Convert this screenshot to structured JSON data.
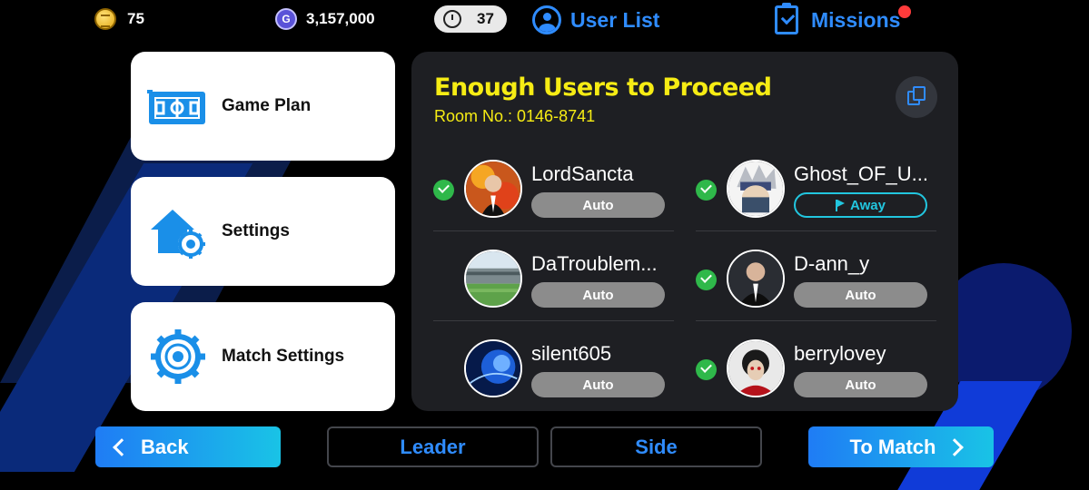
{
  "topbar": {
    "coins": "75",
    "gp": "3,157,000",
    "stamina": "37",
    "user_list_label": "User List",
    "missions_label": "Missions",
    "missions_notification": true
  },
  "menu": {
    "items": [
      {
        "label": "Game Plan",
        "icon": "game-plan-icon"
      },
      {
        "label": "Settings",
        "icon": "settings-icon"
      },
      {
        "label": "Match Settings",
        "icon": "match-settings-icon"
      }
    ]
  },
  "room": {
    "title": "Enough Users to Proceed",
    "room_no": "Room No.: 0146-8741",
    "copy_icon": "copy-icon",
    "users": [
      {
        "name": "LordSancta",
        "status": "Auto",
        "ready": true
      },
      {
        "name": "Ghost_OF_U...",
        "status": "Away",
        "ready": true
      },
      {
        "name": "DaTroublem...",
        "status": "Auto",
        "ready": false
      },
      {
        "name": "D-ann_y",
        "status": "Auto",
        "ready": true
      },
      {
        "name": "silent605",
        "status": "Auto",
        "ready": false
      },
      {
        "name": "berrylovey",
        "status": "Auto",
        "ready": true
      }
    ]
  },
  "buttons": {
    "back": "Back",
    "leader": "Leader",
    "side": "Side",
    "to_match": "To Match"
  },
  "colors": {
    "accent_blue": "#2f8cff",
    "title_yellow": "#f6ec14",
    "ready_green": "#2fb84a",
    "away_cyan": "#22c6df"
  }
}
